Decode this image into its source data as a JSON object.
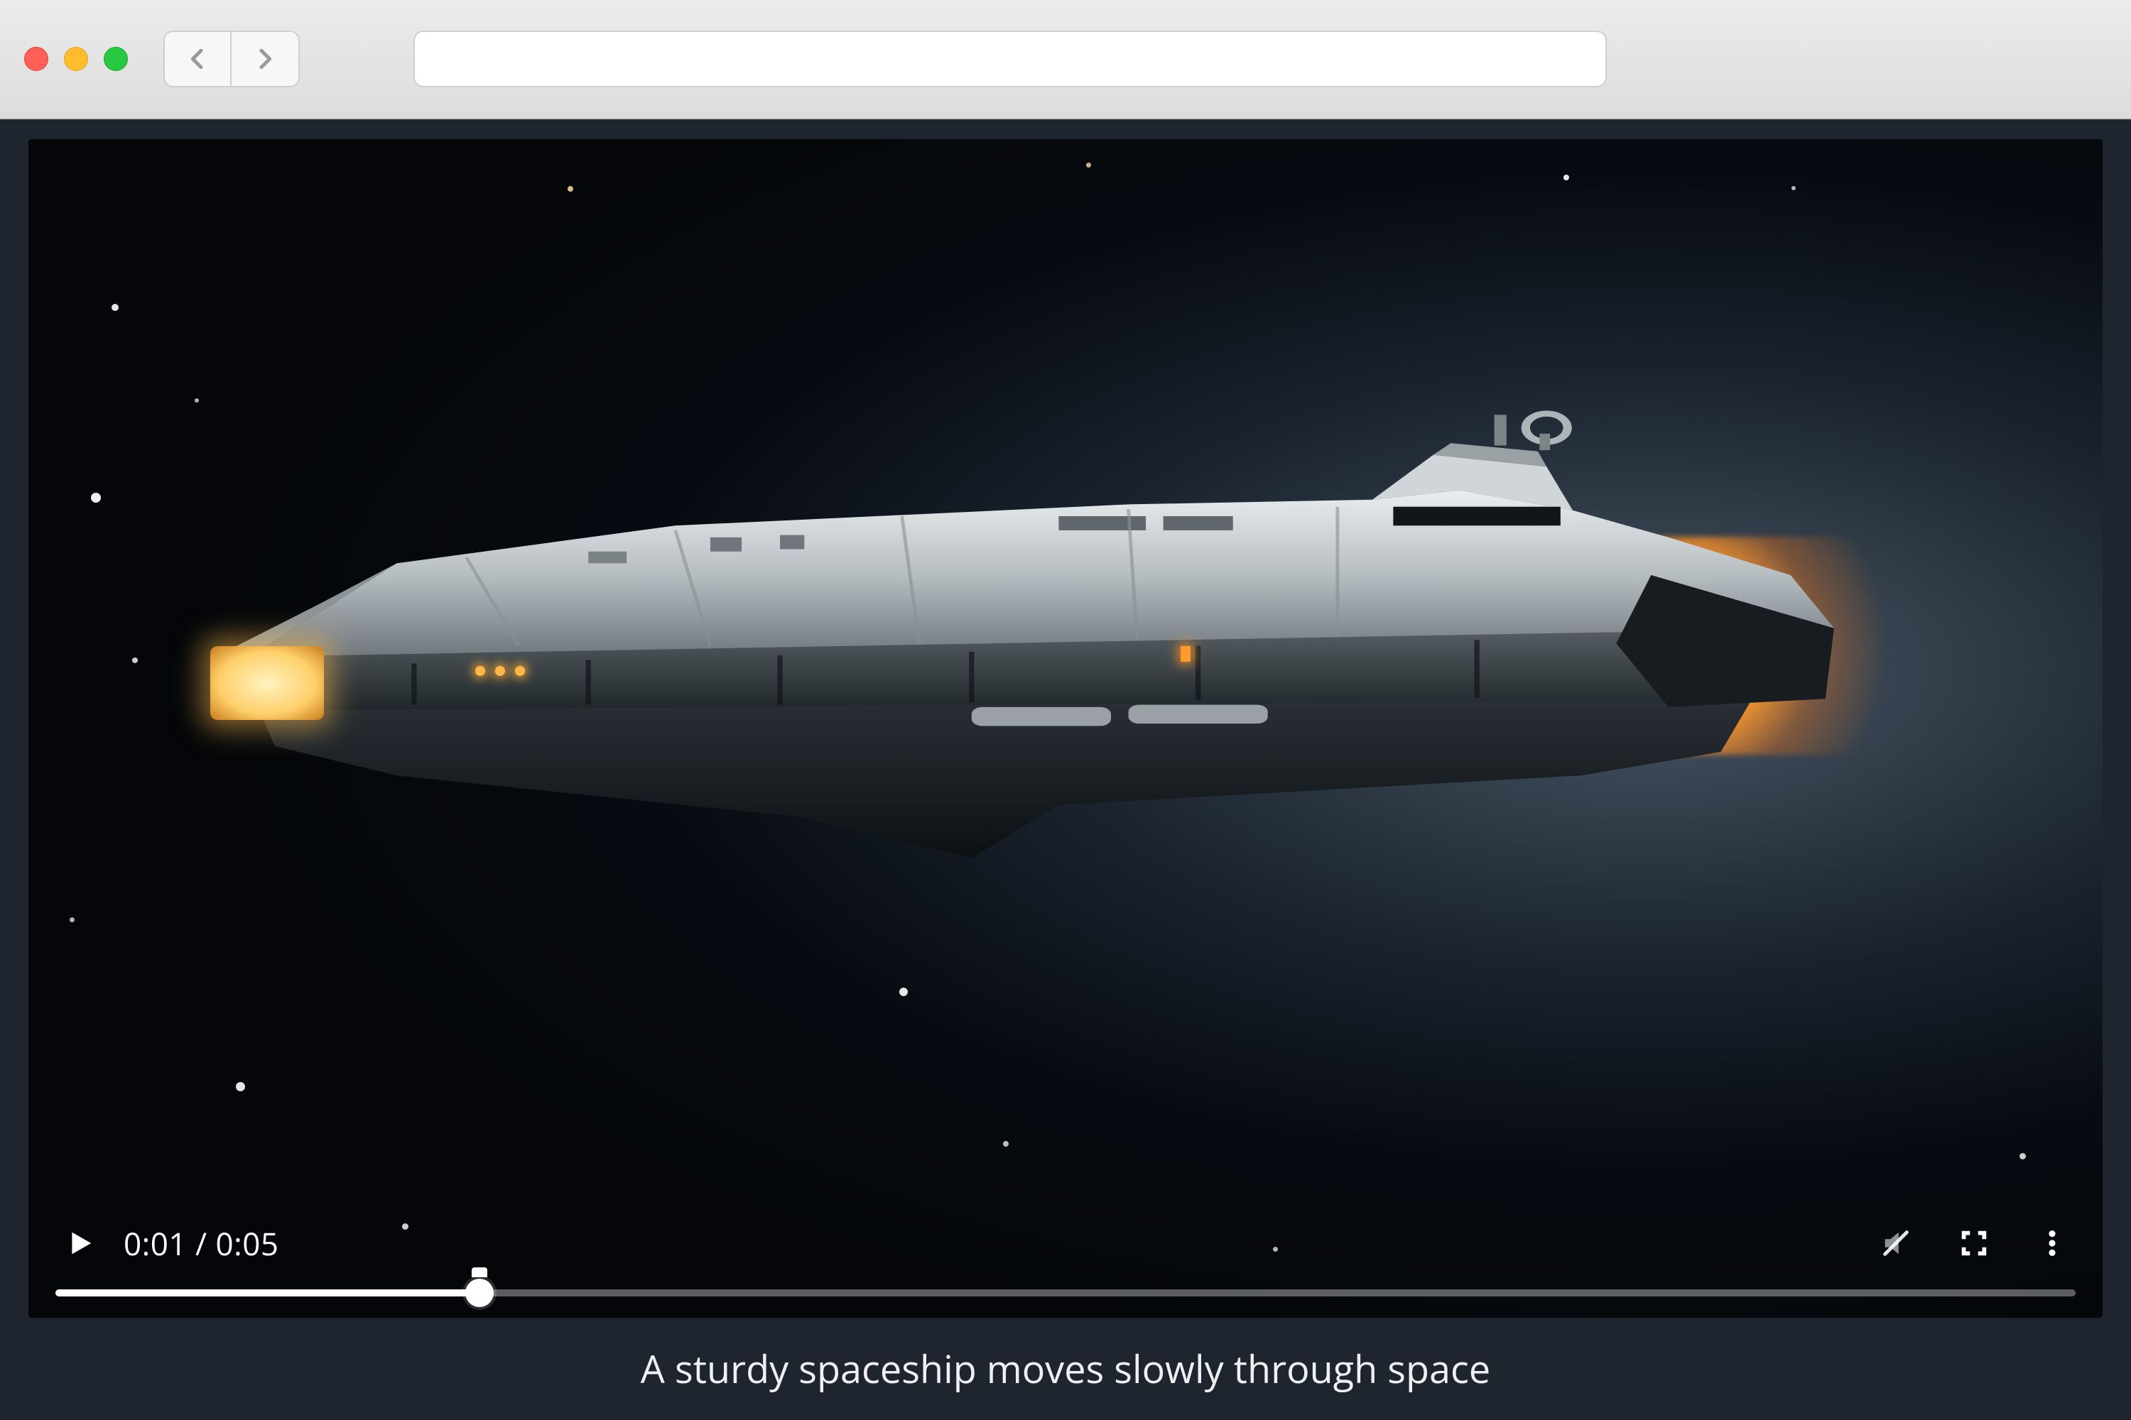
{
  "browser": {
    "address_value": ""
  },
  "video": {
    "current_time": "0:01",
    "duration": "0:05",
    "time_display": "0:01 / 0:05",
    "progress_percent": 21,
    "muted": true
  },
  "caption": "A sturdy spaceship moves slowly through space"
}
